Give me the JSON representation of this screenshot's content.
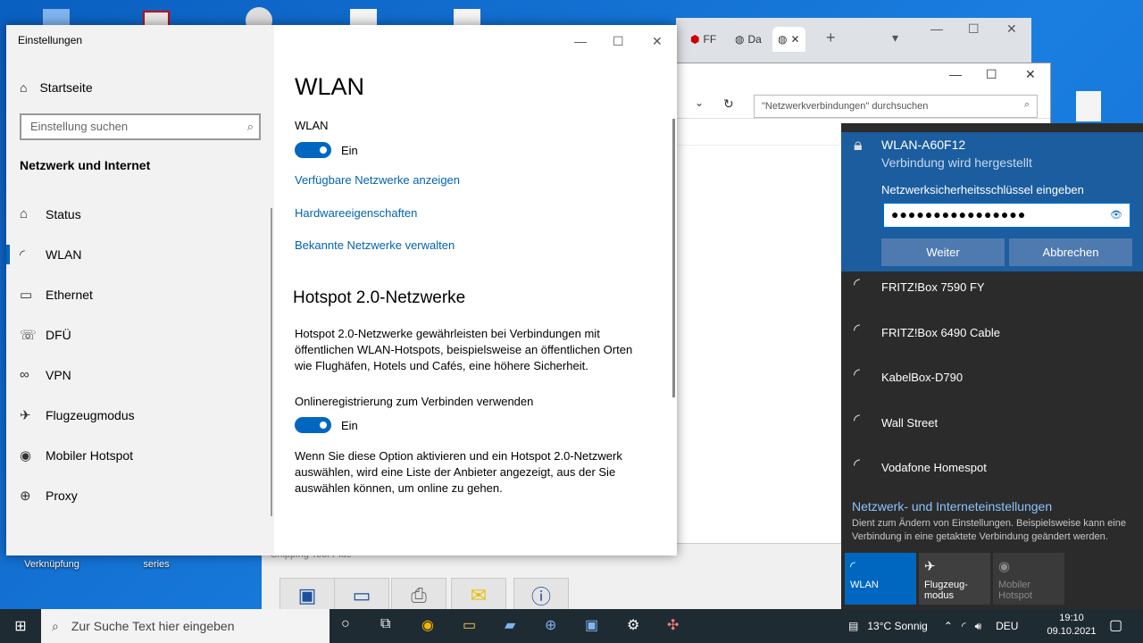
{
  "desktop": {
    "labels": [
      "Verknüpfung",
      "series",
      "Shipping Tool Plus"
    ]
  },
  "browser": {
    "tabs": [
      "FF",
      "Da"
    ],
    "new_tab": "+"
  },
  "explorer": {
    "search_placeholder": "\"Netzwerkverbindungen\" durchsuchen"
  },
  "settings": {
    "window_title": "Einstellungen",
    "home_label": "Startseite",
    "search_placeholder": "Einstellung suchen",
    "section_title": "Netzwerk und Internet",
    "nav_items": [
      {
        "label": "Status",
        "icon": "home-status-icon"
      },
      {
        "label": "WLAN",
        "icon": "wifi-icon"
      },
      {
        "label": "Ethernet",
        "icon": "ethernet-icon"
      },
      {
        "label": "DFÜ",
        "icon": "dialup-icon"
      },
      {
        "label": "VPN",
        "icon": "vpn-icon"
      },
      {
        "label": "Flugzeugmodus",
        "icon": "airplane-icon"
      },
      {
        "label": "Mobiler Hotspot",
        "icon": "hotspot-icon"
      },
      {
        "label": "Proxy",
        "icon": "globe-icon"
      }
    ],
    "page_title": "WLAN",
    "wlan_label": "WLAN",
    "wlan_toggle_state": "Ein",
    "links": [
      "Verfügbare Netzwerke anzeigen",
      "Hardwareeigenschaften",
      "Bekannte Netzwerke verwalten"
    ],
    "hotspot_heading": "Hotspot 2.0-Netzwerke",
    "hotspot_desc": "Hotspot 2.0-Netzwerke gewährleisten bei Verbindungen mit öffentlichen WLAN-Hotspots, beispielsweise an öffentlichen Orten wie Flughäfen, Hotels und Cafés, eine höhere Sicherheit.",
    "online_reg_label": "Onlineregistrierung zum Verbinden verwenden",
    "online_reg_state": "Ein",
    "online_reg_desc": "Wenn Sie diese Option aktivieren und ein Hotspot 2.0-Netzwerk auswählen, wird eine Liste der Anbieter angezeigt, aus der Sie auswählen können, um online zu gehen."
  },
  "flyout": {
    "active_network": "WLAN-A60F12",
    "active_status": "Verbindung wird hergestellt",
    "key_prompt": "Netzwerksicherheitsschlüssel eingeben",
    "key_value": "●●●●●●●●●●●●●●●●",
    "next_button": "Weiter",
    "cancel_button": "Abbrechen",
    "networks": [
      "FRITZ!Box 7590 FY",
      "FRITZ!Box 6490 Cable",
      "KabelBox-D790",
      "Wall Street",
      "Vodafone Homespot"
    ],
    "settings_link": "Netzwerk- und Interneteinstellungen",
    "settings_desc": "Dient zum Ändern von Einstellungen. Beispielsweise kann eine Verbindung in eine getaktete Verbindung geändert werden.",
    "quick_actions": [
      {
        "label": "WLAN",
        "state": "on"
      },
      {
        "label": "Flugzeug-\nmodus",
        "state": "off"
      },
      {
        "label": "Mobiler\nHotspot",
        "state": "disabled"
      }
    ]
  },
  "taskbar": {
    "search_placeholder": "Zur Suche Text hier eingeben",
    "weather": "13°C  Sonnig",
    "language": "DEU",
    "time": "19:10",
    "date": "09.10.2021"
  },
  "colors": {
    "accent": "#0067c0",
    "link": "#0063b1",
    "flyout_bg": "#2b2b2b",
    "flyout_active": "#1b5d9e"
  }
}
